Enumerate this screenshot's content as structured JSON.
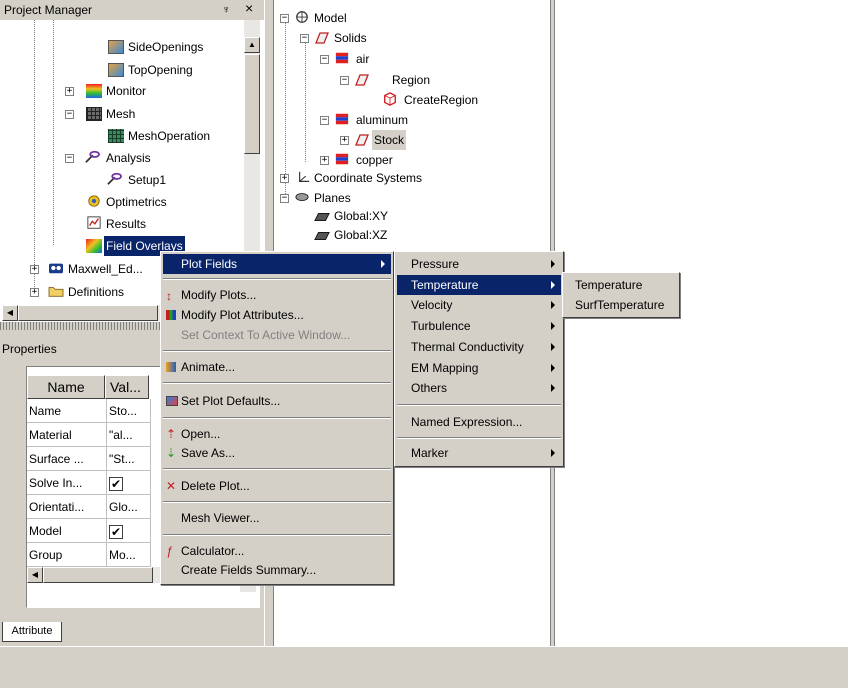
{
  "project_manager": {
    "title": "Project Manager",
    "pin_glyph": "♆",
    "close_glyph": "×",
    "tree": [
      {
        "label": "SideOpenings",
        "indent": 0
      },
      {
        "label": "TopOpening",
        "indent": 0
      },
      {
        "label": "Monitor",
        "indent": 0
      },
      {
        "label": "Mesh",
        "indent": 0
      },
      {
        "label": "MeshOperation",
        "indent": 1
      },
      {
        "label": "Analysis",
        "indent": 0
      },
      {
        "label": "Setup1",
        "indent": 1
      },
      {
        "label": "Optimetrics",
        "indent": 0
      },
      {
        "label": "Results",
        "indent": 0
      },
      {
        "label": "Field Overlays",
        "indent": 0
      },
      {
        "label": "Maxwell_Ed...",
        "indent": -1
      },
      {
        "label": "Definitions",
        "indent": -1
      }
    ]
  },
  "model_tree": [
    {
      "label": "Model"
    },
    {
      "label": "Solids"
    },
    {
      "label": "air"
    },
    {
      "label": "Region"
    },
    {
      "label": "CreateRegion"
    },
    {
      "label": "aluminum"
    },
    {
      "label": "Stock"
    },
    {
      "label": "copper"
    },
    {
      "label": "Coordinate Systems"
    },
    {
      "label": "Planes"
    },
    {
      "label": "Global:XY"
    },
    {
      "label": "Global:XZ"
    }
  ],
  "properties": {
    "title": "Properties",
    "columns": [
      "Name",
      "Val..."
    ],
    "rows": [
      {
        "name": "Name",
        "value": "Sto..."
      },
      {
        "name": "Material",
        "value": "\"al..."
      },
      {
        "name": "Surface ...",
        "value": "\"St..."
      },
      {
        "name": "Solve In...",
        "value": "✔"
      },
      {
        "name": "Orientati...",
        "value": "Glo..."
      },
      {
        "name": "Model",
        "value": "✔"
      },
      {
        "name": "Group",
        "value": "Mo..."
      }
    ],
    "tab": "Attribute"
  },
  "context_menu": {
    "items": [
      {
        "label": "Plot Fields"
      },
      {
        "label": "Modify Plots..."
      },
      {
        "label": "Modify Plot Attributes..."
      },
      {
        "label": "Set Context To Active Window..."
      },
      {
        "label": "Animate..."
      },
      {
        "label": "Set Plot Defaults..."
      },
      {
        "label": "Open..."
      },
      {
        "label": "Save As..."
      },
      {
        "label": "Delete Plot..."
      },
      {
        "label": "Mesh Viewer..."
      },
      {
        "label": "Calculator..."
      },
      {
        "label": "Create Fields Summary..."
      }
    ]
  },
  "plot_fields_menu": {
    "items": [
      {
        "label": "Pressure"
      },
      {
        "label": "Temperature"
      },
      {
        "label": "Velocity"
      },
      {
        "label": "Turbulence"
      },
      {
        "label": "Thermal Conductivity"
      },
      {
        "label": "EM Mapping"
      },
      {
        "label": "Others"
      },
      {
        "label": "Named Expression..."
      },
      {
        "label": "Marker"
      }
    ]
  },
  "temperature_menu": {
    "items": [
      {
        "label": "Temperature"
      },
      {
        "label": "SurfTemperature"
      }
    ]
  }
}
